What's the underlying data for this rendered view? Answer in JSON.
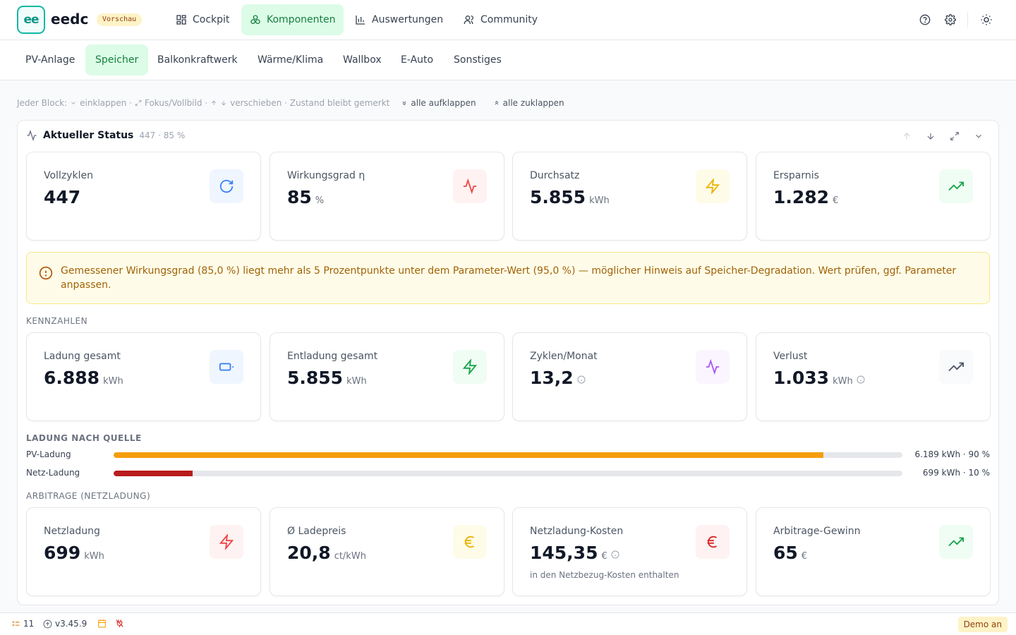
{
  "app": {
    "logo_text": "ee",
    "brand": "eedc",
    "badge": "Vorschau"
  },
  "nav": {
    "items": [
      {
        "label": "Cockpit",
        "icon": "dashboard-icon"
      },
      {
        "label": "Komponenten",
        "icon": "components-icon",
        "active": true
      },
      {
        "label": "Auswertungen",
        "icon": "bar-chart-icon"
      },
      {
        "label": "Community",
        "icon": "users-icon"
      }
    ],
    "right_icons": [
      "help-icon",
      "settings-icon",
      "sun-icon"
    ]
  },
  "subnav": {
    "tabs": [
      {
        "label": "PV-Anlage"
      },
      {
        "label": "Speicher",
        "active": true
      },
      {
        "label": "Balkonkraftwerk"
      },
      {
        "label": "Wärme/Klima"
      },
      {
        "label": "Wallbox"
      },
      {
        "label": "E-Auto"
      },
      {
        "label": "Sonstiges"
      }
    ]
  },
  "hint": {
    "prefix": "Jeder Block:",
    "collapse": "einklappen ·",
    "focus": "Fokus/Vollbild ·",
    "move": "verschieben · Zustand bleibt gemerkt",
    "expand_all": "alle aufklappen",
    "collapse_all": "alle zuklappen"
  },
  "panel": {
    "title": "Aktueller Status",
    "meta": "447 · 85 %"
  },
  "status_cards": [
    {
      "label": "Vollzyklen",
      "value": "447",
      "unit": "",
      "icon": "refresh-icon",
      "color": "#3b82f6",
      "bg": "#eff6ff"
    },
    {
      "label": "Wirkungsgrad η",
      "value": "85",
      "unit": "%",
      "icon": "activity-icon",
      "color": "#ef4444",
      "bg": "#fef2f2"
    },
    {
      "label": "Durchsatz",
      "value": "5.855",
      "unit": "kWh",
      "icon": "zap-icon",
      "color": "#eab308",
      "bg": "#fefce8"
    },
    {
      "label": "Ersparnis",
      "value": "1.282",
      "unit": "€",
      "icon": "trending-up-icon",
      "color": "#16a34a",
      "bg": "#f0fdf4"
    }
  ],
  "warning": {
    "text": "Gemessener Wirkungsgrad (85,0 %) liegt mehr als 5 Prozentpunkte unter dem Parameter-Wert (95,0 %) — möglicher Hinweis auf Speicher-Degradation. Wert prüfen, ggf. Parameter anpassen."
  },
  "kennzahlen": {
    "heading": "KENNZAHLEN",
    "cards": [
      {
        "label": "Ladung gesamt",
        "value": "6.888",
        "unit": "kWh",
        "icon": "battery-icon",
        "color": "#3b82f6",
        "bg": "#eff6ff",
        "info": false
      },
      {
        "label": "Entladung gesamt",
        "value": "5.855",
        "unit": "kWh",
        "icon": "zap-icon",
        "color": "#16a34a",
        "bg": "#f0fdf4",
        "info": false
      },
      {
        "label": "Zyklen/Monat",
        "value": "13,2",
        "unit": "",
        "icon": "activity-icon",
        "color": "#a855f7",
        "bg": "#faf5ff",
        "info": true
      },
      {
        "label": "Verlust",
        "value": "1.033",
        "unit": "kWh",
        "icon": "trending-up-icon",
        "color": "#4b5563",
        "bg": "#f9fafb",
        "info": true
      }
    ]
  },
  "ladung": {
    "heading": "LADUNG NACH QUELLE",
    "rows": [
      {
        "label": "PV-Ladung",
        "value": "6.189 kWh · 90 %",
        "fraction": 0.9,
        "color": "#f59e0b"
      },
      {
        "label": "Netz-Ladung",
        "value": "699 kWh · 10 %",
        "fraction": 0.1,
        "color": "#b91c1c"
      }
    ]
  },
  "arbitrage": {
    "heading": "ARBITRAGE (NETZLADUNG)",
    "cards": [
      {
        "label": "Netzladung",
        "value": "699",
        "unit": "kWh",
        "icon": "zap-icon",
        "color": "#ef4444",
        "bg": "#fef2f2",
        "info": false,
        "sub": ""
      },
      {
        "label": "Ø Ladepreis",
        "value": "20,8",
        "unit": "ct/kWh",
        "icon": "euro-icon",
        "color": "#eab308",
        "bg": "#fefce8",
        "info": false,
        "sub": ""
      },
      {
        "label": "Netzladung-Kosten",
        "value": "145,35",
        "unit": "€",
        "icon": "euro-icon",
        "color": "#dc2626",
        "bg": "#fef2f2",
        "info": true,
        "sub": "in den Netzbezug-Kosten enthalten"
      },
      {
        "label": "Arbitrage-Gewinn",
        "value": "65",
        "unit": "€",
        "icon": "trending-up-icon",
        "color": "#16a34a",
        "bg": "#f0fdf4",
        "info": false,
        "sub": ""
      }
    ]
  },
  "footer": {
    "tasks": "11",
    "version": "v3.45.9",
    "demo": "Demo an"
  }
}
